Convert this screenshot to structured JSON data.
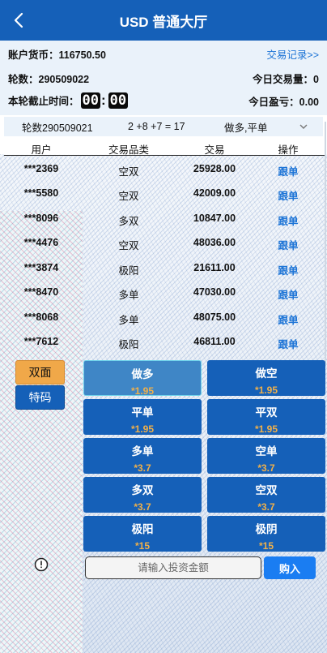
{
  "header": {
    "title": "USD 普通大厅"
  },
  "account": {
    "balance_label": "账户货币：",
    "balance_value": "116750.50",
    "history_link": "交易记录>>",
    "round_label": "轮数：",
    "round_value": "290509022",
    "today_volume_label": "今日交易量：",
    "today_volume_value": "0",
    "deadline_label": "本轮截止时间：",
    "timer_minutes": "00",
    "timer_seconds": "00",
    "today_profit_label": "今日盈亏：",
    "today_profit_value": "0.00"
  },
  "last_round": {
    "round": "轮数290509021",
    "formula": "2 +8 +7 = 17",
    "result": "做多,平单"
  },
  "table": {
    "headers": [
      "用户",
      "交易品类",
      "交易",
      "操作"
    ],
    "rows": [
      {
        "user": "***2369",
        "type": "空双",
        "amount": "25928.00",
        "action": "跟单"
      },
      {
        "user": "***5580",
        "type": "空双",
        "amount": "42009.00",
        "action": "跟单"
      },
      {
        "user": "***8096",
        "type": "多双",
        "amount": "10847.00",
        "action": "跟单"
      },
      {
        "user": "***4476",
        "type": "空双",
        "amount": "48036.00",
        "action": "跟单"
      },
      {
        "user": "***3874",
        "type": "极阳",
        "amount": "21611.00",
        "action": "跟单"
      },
      {
        "user": "***8470",
        "type": "多单",
        "amount": "47030.00",
        "action": "跟单"
      },
      {
        "user": "***8068",
        "type": "多单",
        "amount": "48075.00",
        "action": "跟单"
      },
      {
        "user": "***7612",
        "type": "极阳",
        "amount": "46811.00",
        "action": "跟单"
      }
    ]
  },
  "side_tabs": [
    {
      "label": "双面",
      "active": true
    },
    {
      "label": "特码",
      "active": false
    }
  ],
  "bets": [
    {
      "name": "做多",
      "odds": "*1.95",
      "selected": true
    },
    {
      "name": "做空",
      "odds": "*1.95",
      "selected": false
    },
    {
      "name": "平单",
      "odds": "*1.95",
      "selected": false
    },
    {
      "name": "平双",
      "odds": "*1.95",
      "selected": false
    },
    {
      "name": "多单",
      "odds": "*3.7",
      "selected": false
    },
    {
      "name": "空单",
      "odds": "*3.7",
      "selected": false
    },
    {
      "name": "多双",
      "odds": "*3.7",
      "selected": false
    },
    {
      "name": "空双",
      "odds": "*3.7",
      "selected": false
    },
    {
      "name": "极阳",
      "odds": "*15",
      "selected": false
    },
    {
      "name": "极阴",
      "odds": "*15",
      "selected": false
    }
  ],
  "order": {
    "placeholder": "请输入投资金额",
    "buy_label": "购入"
  },
  "colors": {
    "primary": "#1560b8",
    "accent_orange": "#f0a849",
    "link_blue": "#1b73d6",
    "odds_orange": "#f0b04a"
  }
}
